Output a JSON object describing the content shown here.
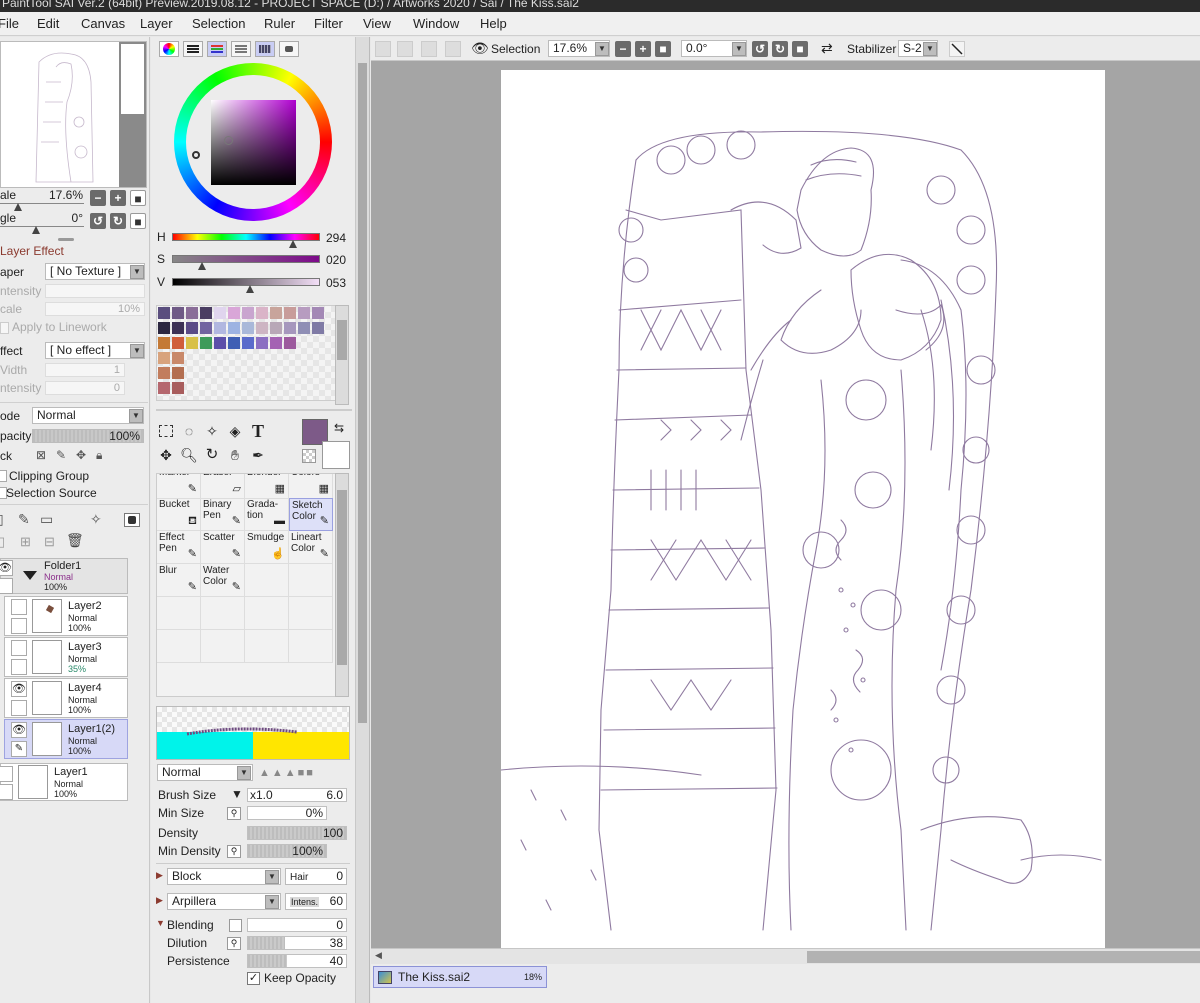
{
  "app": {
    "title": "PaintTool SAI Ver.2 (64bit) Preview.2019.08.12 - PROJECT SPACE (D:) / Artworks 2020 / Sai / The Kiss.sai2"
  },
  "menu": [
    "File",
    "Edit",
    "Canvas",
    "Layer",
    "Selection",
    "Ruler",
    "Filter",
    "View",
    "Window",
    "Help"
  ],
  "navigator": {
    "scale_label": "ale",
    "scale_value": "17.6%",
    "angle_label": "gle",
    "angle_value": "0°"
  },
  "layer_effect": {
    "heading": "Layer Effect",
    "paper_label": "aper",
    "paper_value": "[ No Texture ]",
    "intensity_label": "ntensity",
    "scale_label": "cale",
    "scale_value": "10%",
    "apply_linework": "Apply to Linework",
    "effect_label": "ffect",
    "effect_value": "[ No effect ]",
    "width_label": "Vidth",
    "width_value": "1",
    "intensity2_label": "ntensity",
    "intensity2_value": "0"
  },
  "layer_props": {
    "mode_label": "ode",
    "mode_value": "Normal",
    "opacity_label": "pacity",
    "opacity_value": "100%",
    "opacity_level": 1.0,
    "lock_label": "ck",
    "clipping_group": "Clipping Group",
    "selection_source": "Selection Source"
  },
  "layers": [
    {
      "name": "Folder1",
      "mode": "Normal",
      "opacity": "100%",
      "visible": true,
      "folder": true
    },
    {
      "name": "Layer2",
      "mode": "Normal",
      "opacity": "100%",
      "visible": false
    },
    {
      "name": "Layer3",
      "mode": "Normal",
      "opacity": "35%",
      "visible": false
    },
    {
      "name": "Layer4",
      "mode": "Normal",
      "opacity": "100%",
      "visible": true
    },
    {
      "name": "Layer1(2)",
      "mode": "Normal",
      "opacity": "100%",
      "visible": true,
      "selected": true
    },
    {
      "name": "Layer1",
      "mode": "Normal",
      "opacity": "100%",
      "visible": false
    }
  ],
  "color": {
    "current": "#7d5a88",
    "h_label": "H",
    "h_value": "294",
    "h_level": 0.82,
    "s_label": "S",
    "s_value": "020",
    "s_level": 0.2,
    "v_label": "V",
    "v_value": "053",
    "v_level": 0.53
  },
  "swatches": [
    "#5a4e7e",
    "#6f5a86",
    "#8a6d98",
    "#4a3d62",
    "#e0d5ee",
    "#d9a6d8",
    "#c9a5cf",
    "#dab4c8",
    "#c8a49b",
    "#c89c9a",
    "#b79cc0",
    "#a388b5",
    "#2b2740",
    "#3c3055",
    "#5a4a86",
    "#7163a0",
    "#b1b7e0",
    "#9db3e2",
    "#a9b8d9",
    "#cdb5c3",
    "#b8a7b7",
    "#a697bd",
    "#8f8eb5",
    "#7f7aa5",
    "#c47a36",
    "#d05e3b",
    "#d8c048",
    "#3d9b5a",
    "#5c4fa9",
    "#3f5fb4",
    "#5a6bcb",
    "#8b6fc2",
    "#a462b3",
    "#9c5a9d",
    "",
    "",
    "#d8a37d",
    "#c9896a",
    "",
    "",
    "",
    "",
    "",
    "",
    "",
    "",
    "",
    "",
    "#c27d5d",
    "#b36e50",
    "",
    "",
    "",
    "",
    "",
    "",
    "",
    "",
    "",
    "",
    "#b5676e",
    "#a85d5d",
    "",
    "",
    "",
    "",
    "",
    "",
    "",
    "",
    "",
    ""
  ],
  "brushes": [
    {
      "row": 0,
      "col": 0,
      "label": "Marker",
      "icon": "✎",
      "partial": true
    },
    {
      "row": 0,
      "col": 1,
      "label": "Eraser",
      "icon": "▱",
      "partial": true
    },
    {
      "row": 0,
      "col": 2,
      "label": "Blender",
      "icon": "▦",
      "partial": true
    },
    {
      "row": 0,
      "col": 3,
      "label": "Colors",
      "icon": "▦",
      "partial": true
    },
    {
      "row": 1,
      "col": 0,
      "label": "Bucket",
      "icon": "⛾"
    },
    {
      "row": 1,
      "col": 1,
      "label": "Binary Pen",
      "icon": "✎"
    },
    {
      "row": 1,
      "col": 2,
      "label": "Grada-tion",
      "icon": "▬"
    },
    {
      "row": 1,
      "col": 3,
      "label": "Sketch Color",
      "icon": "✎",
      "selected": true
    },
    {
      "row": 2,
      "col": 0,
      "label": "Effect Pen",
      "icon": "✎"
    },
    {
      "row": 2,
      "col": 1,
      "label": "Scatter",
      "icon": "✎"
    },
    {
      "row": 2,
      "col": 2,
      "label": "Smudge",
      "icon": "☝"
    },
    {
      "row": 2,
      "col": 3,
      "label": "Lineart Color",
      "icon": "✎"
    },
    {
      "row": 3,
      "col": 0,
      "label": "Blur",
      "icon": "✎"
    },
    {
      "row": 3,
      "col": 1,
      "label": "Water Color",
      "icon": "✎"
    }
  ],
  "brush_settings": {
    "blend_mode": "Normal",
    "brush_size_label": "Brush Size",
    "brush_size_mult": "x1.0",
    "brush_size_value": "6.0",
    "min_size_label": "Min Size",
    "min_size_value": "0%",
    "density_label": "Density",
    "density_value": "100",
    "min_density_label": "Min Density",
    "min_density_value": "100%",
    "shape_value": "Block",
    "hair_label": "Hair",
    "hair_value": "0",
    "texture_value": "Arpillera",
    "intens_label": "Intens.",
    "intens_value": "60",
    "blending_label": "Blending",
    "blending_value": "0",
    "dilution_label": "Dilution",
    "dilution_value": "38",
    "dilution_level": 0.38,
    "persistence_label": "Persistence",
    "persistence_value": "40",
    "persistence_level": 0.4,
    "keep_opacity_label": "Keep Opacity"
  },
  "toolbar": {
    "selection_label": "Selection",
    "zoom_value": "17.6%",
    "rotation_value": "0.0°",
    "stabilizer_label": "Stabilizer",
    "stabilizer_value": "S-2"
  },
  "document": {
    "tab_name": "The Kiss.sai2",
    "tab_zoom": "18%"
  }
}
